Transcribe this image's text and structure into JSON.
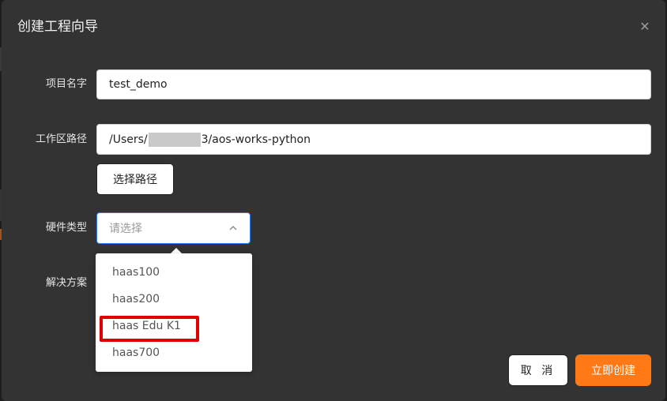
{
  "dialog": {
    "title": "创建工程向导",
    "close_icon": "close-icon"
  },
  "form": {
    "project_name": {
      "label": "项目名字",
      "value": "test_demo"
    },
    "workspace": {
      "label": "工作区路径",
      "value_prefix": "/Users/",
      "value_suffix": "3/aos-works-python",
      "choose_button": "选择路径"
    },
    "hardware": {
      "label": "硬件类型",
      "placeholder": "请选择",
      "options": [
        "haas100",
        "haas200",
        "haas Edu K1",
        "haas700"
      ]
    },
    "solution": {
      "label": "解决方案"
    }
  },
  "footer": {
    "cancel": "取 消",
    "create": "立即创建"
  },
  "colors": {
    "dialog_bg": "#333333",
    "primary": "#ff7a17",
    "focus_border": "#2f7cf6",
    "highlight": "#e00000"
  }
}
